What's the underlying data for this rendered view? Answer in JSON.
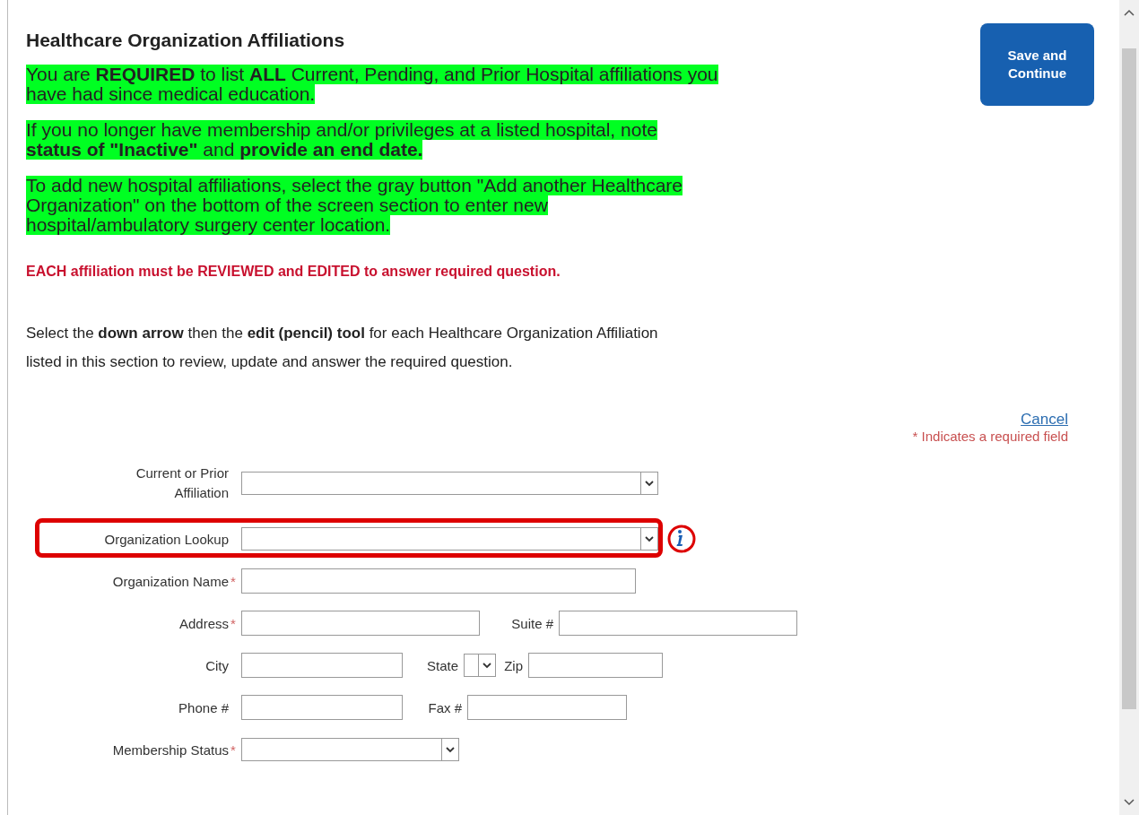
{
  "page": {
    "title": "Healthcare Organization Affiliations",
    "save_button": "Save and Continue"
  },
  "notices": [
    {
      "kind": "highlight",
      "lines": [
        "You are **REQUIRED** to list **ALL** Current, Pending, and Prior Hospital affiliations you",
        "have had since medical education."
      ]
    },
    {
      "kind": "highlight",
      "lines": [
        "If you no longer have membership and/or privileges at a listed hospital, note",
        "**status of \"Inactive\"** and **provide an end date.**"
      ]
    },
    {
      "kind": "highlight",
      "lines": [
        "To add new hospital affiliations, select the gray button \"Add another Healthcare",
        "Organization\" on the bottom of the screen section to enter new",
        "hospital/ambulatory surgery center location."
      ]
    },
    {
      "kind": "warning",
      "lines": [
        "EACH affiliation must be REVIEWED and EDITED to answer required question."
      ]
    },
    {
      "kind": "plain",
      "lines": [
        "Select the **down arrow** then the **edit (pencil) tool** for each Healthcare Organization Affiliation",
        "listed in this section to review, update and answer the required question."
      ]
    }
  ],
  "cancel_link": "Cancel",
  "required_note": "* Indicates a required field",
  "form": {
    "rows": [
      {
        "highlighted": false,
        "info": false,
        "fields": [
          {
            "label": "Current or Prior Affiliation",
            "kind": "select"
          }
        ]
      },
      {
        "highlighted": true,
        "info": true,
        "fields": [
          {
            "label": "Organization Lookup",
            "kind": "select"
          }
        ]
      },
      {
        "highlighted": false,
        "info": false,
        "fields": [
          {
            "label": "Organization Name",
            "required_mark": "*",
            "kind": "text"
          }
        ]
      },
      {
        "highlighted": false,
        "info": false,
        "fields": [
          {
            "label": "Address",
            "required_mark": "*",
            "kind": "text"
          },
          {
            "label": "Suite #",
            "kind": "text"
          }
        ]
      },
      {
        "highlighted": false,
        "info": false,
        "fields": [
          {
            "label": "City",
            "kind": "text"
          },
          {
            "label": "State",
            "kind": "select"
          },
          {
            "label": "Zip",
            "kind": "text"
          }
        ]
      },
      {
        "highlighted": false,
        "info": false,
        "fields": [
          {
            "label": "Phone #",
            "kind": "text"
          },
          {
            "label": "Fax #",
            "kind": "text"
          }
        ]
      },
      {
        "highlighted": false,
        "info": false,
        "fields": [
          {
            "label": "Membership Status",
            "required_mark": "*",
            "kind": "select"
          }
        ]
      }
    ]
  }
}
